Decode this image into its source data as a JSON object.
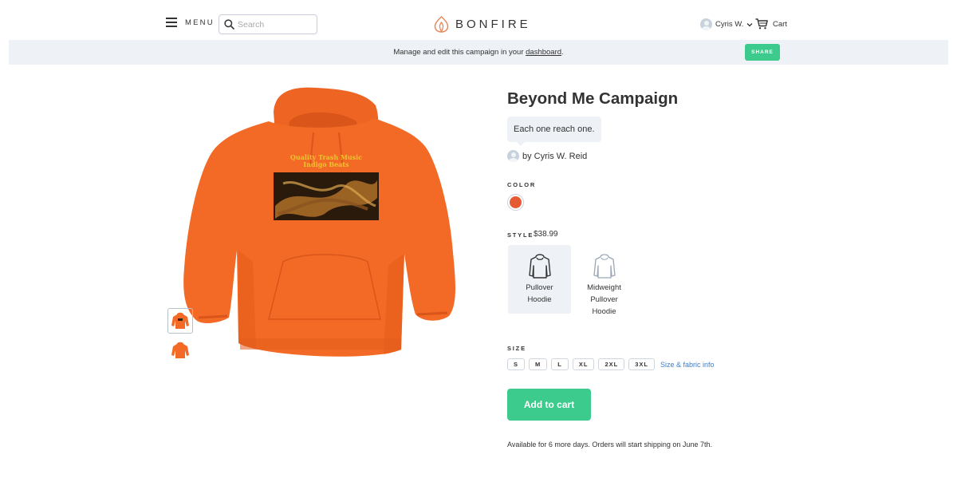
{
  "header": {
    "menu_label": "MENU",
    "search_placeholder": "Search",
    "logo_text": "BONFIRE",
    "user_name": "Cyris W.",
    "cart_label": "Cart"
  },
  "banner": {
    "text_before": "Manage and edit this campaign in your ",
    "link_text": "dashboard",
    "text_after": ".",
    "share_label": "SHARE"
  },
  "product": {
    "title": "Beyond Me Campaign",
    "tagline": "Each one reach one.",
    "author": "by Cyris W. Reid",
    "print_line_1": "Quality Trash Music",
    "print_line_2": "Indigo Beats",
    "color_label": "COLOR",
    "selected_color": "#e55a33",
    "style_label": "STYLE",
    "price": "$38.99",
    "styles": [
      {
        "line1": "Pullover",
        "line2": "Hoodie",
        "line3": ""
      },
      {
        "line1": "Midweight",
        "line2": "Pullover",
        "line3": "Hoodie"
      }
    ],
    "size_label": "SIZE",
    "sizes": [
      "S",
      "M",
      "L",
      "XL",
      "2XL",
      "3XL"
    ],
    "size_info_link": "Size & fabric info",
    "add_to_cart": "Add to cart",
    "availability": "Available for 6 more days. Orders will start shipping on June 7th."
  },
  "colors": {
    "accent_green": "#3ccb8c",
    "hoodie_orange": "#f26a25",
    "link_blue": "#3d7cc9"
  }
}
